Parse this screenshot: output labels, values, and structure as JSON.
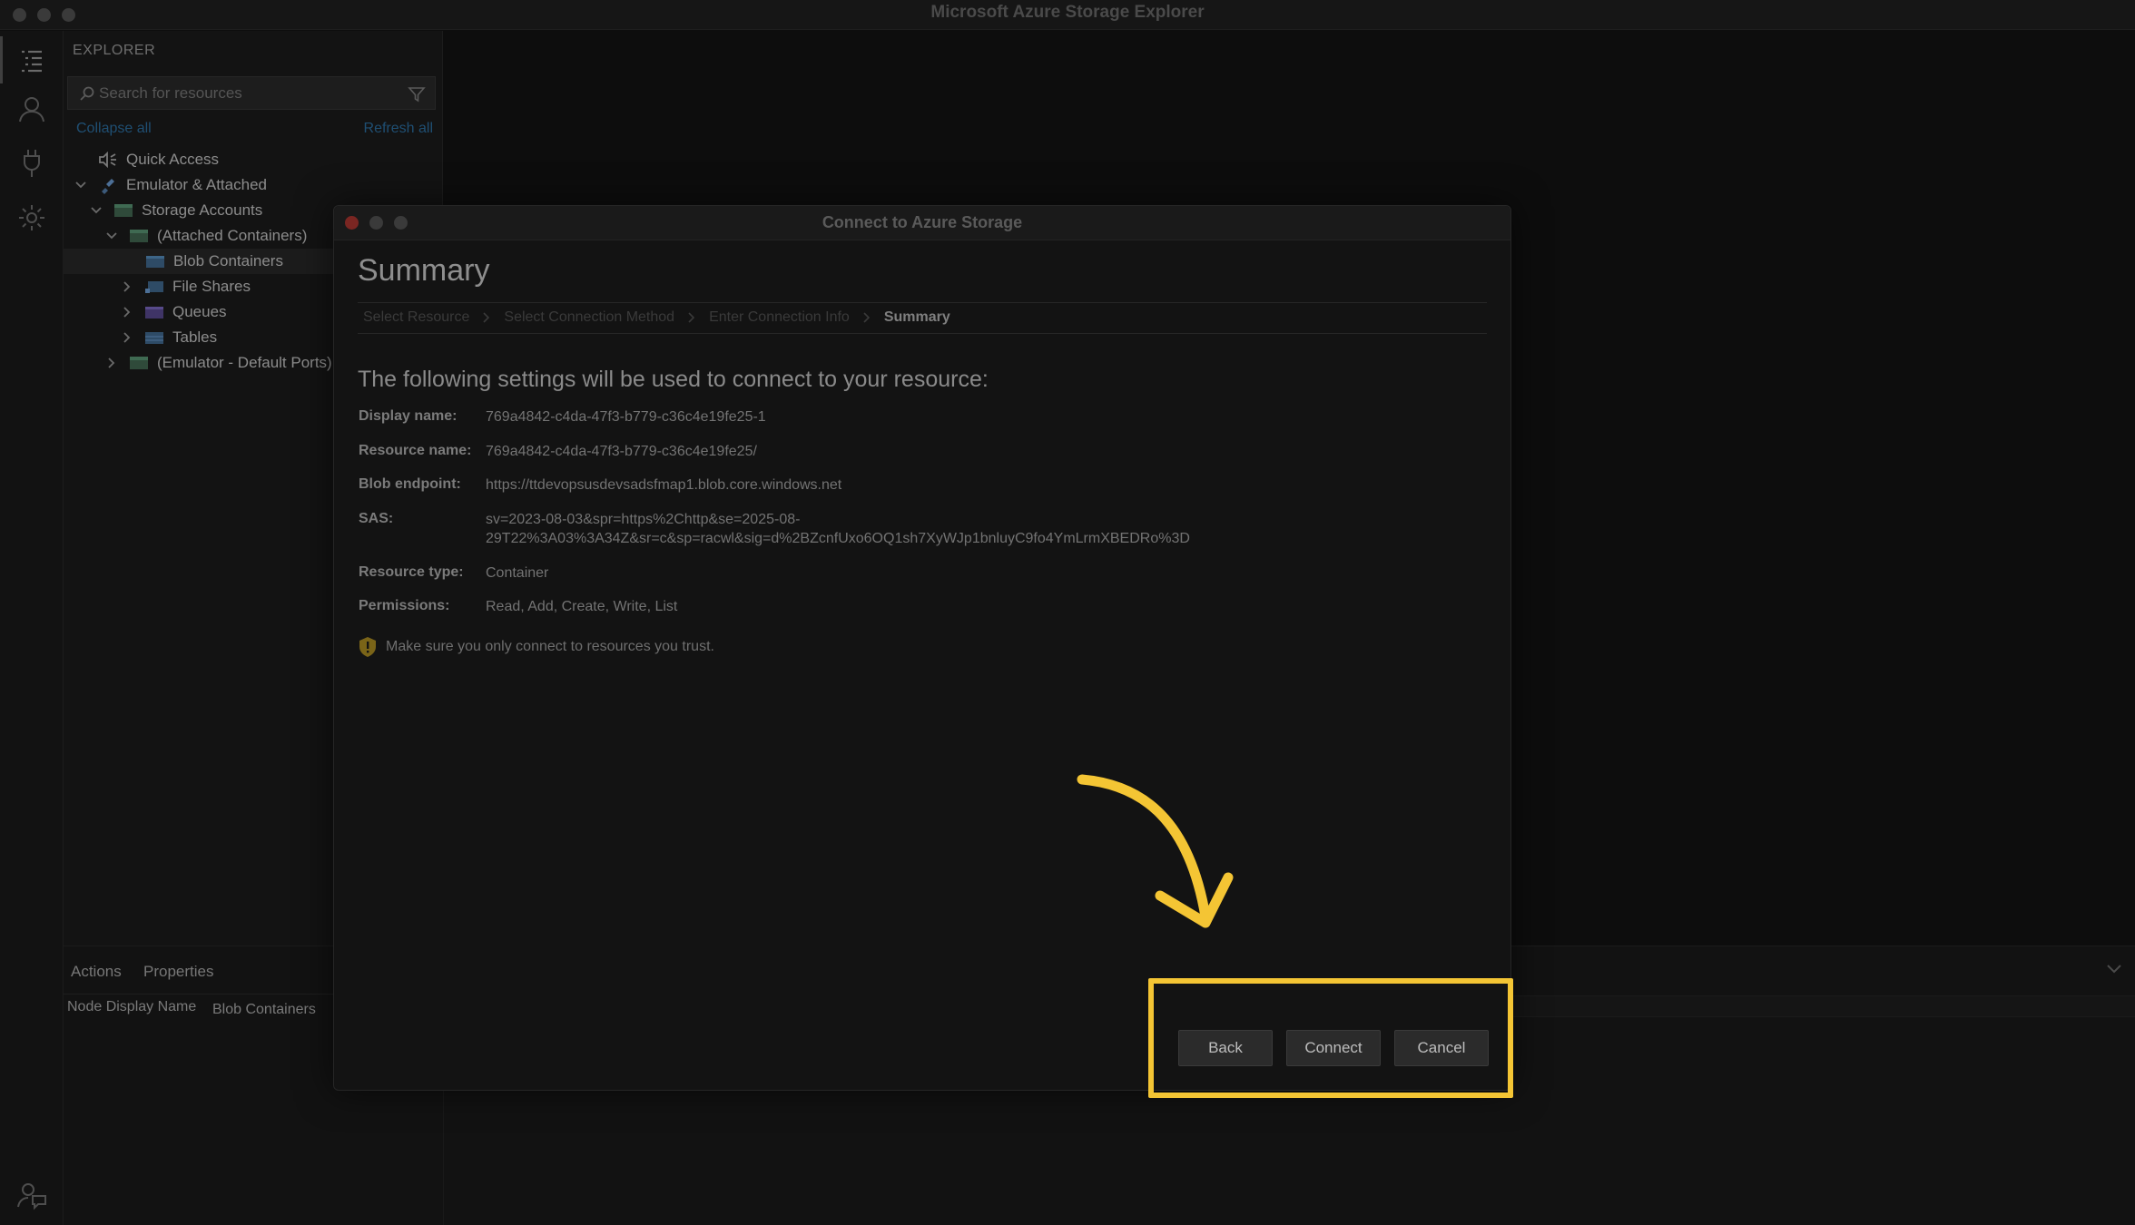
{
  "app": {
    "title": "Microsoft Azure Storage Explorer"
  },
  "explorer": {
    "header": "EXPLORER",
    "search_placeholder": "Search for resources",
    "collapse_all": "Collapse all",
    "refresh_all": "Refresh all",
    "tree": [
      {
        "label": "Quick Access",
        "icon": "quick-access-icon"
      },
      {
        "label": "Emulator & Attached",
        "icon": "plug-icon"
      },
      {
        "label": "Storage Accounts",
        "icon": "storage-account-icon"
      },
      {
        "label": "(Attached Containers)",
        "icon": "storage-account-icon"
      },
      {
        "label": "Blob Containers",
        "icon": "blob-container-icon"
      },
      {
        "label": "File Shares",
        "icon": "file-share-icon"
      },
      {
        "label": "Queues",
        "icon": "queue-icon"
      },
      {
        "label": "Tables",
        "icon": "table-icon"
      },
      {
        "label": "(Emulator - Default Ports)",
        "icon": "storage-account-icon"
      }
    ]
  },
  "bottom_panel": {
    "tabs": [
      "Actions",
      "Properties"
    ],
    "property_label": "Node Display Name",
    "property_value": "Blob Containers"
  },
  "dialog": {
    "title": "Connect to Azure Storage",
    "heading": "Summary",
    "steps": [
      "Select Resource",
      "Select Connection Method",
      "Enter Connection Info",
      "Summary"
    ],
    "intro": "The following settings will be used to connect to your resource:",
    "fields": [
      {
        "label": "Display name:",
        "value": "769a4842-c4da-47f3-b779-c36c4e19fe25-1"
      },
      {
        "label": "Resource name:",
        "value": "769a4842-c4da-47f3-b779-c36c4e19fe25/"
      },
      {
        "label": "Blob endpoint:",
        "value": "https://ttdevopsusdevsadsfmap1.blob.core.windows.net"
      },
      {
        "label": "SAS:",
        "value_line1": "sv=2023-08-03&spr=https%2Chttp&se=2025-08-",
        "value_line2": "29T22%3A03%3A34Z&sr=c&sp=racwl&sig=d%2BZcnfUxo6OQ1sh7XyWJp1bnluyC9fo4YmLrmXBEDRo%3D"
      },
      {
        "label": "Resource type:",
        "value": "Container"
      },
      {
        "label": "Permissions:",
        "value": "Read, Add, Create, Write, List"
      }
    ],
    "warning": "Make sure you only connect to resources you trust.",
    "buttons": {
      "back": "Back",
      "connect": "Connect",
      "cancel": "Cancel"
    }
  },
  "colors": {
    "highlight": "#f4c534",
    "background": "#0d0d0d",
    "link": "#1f4f73"
  }
}
